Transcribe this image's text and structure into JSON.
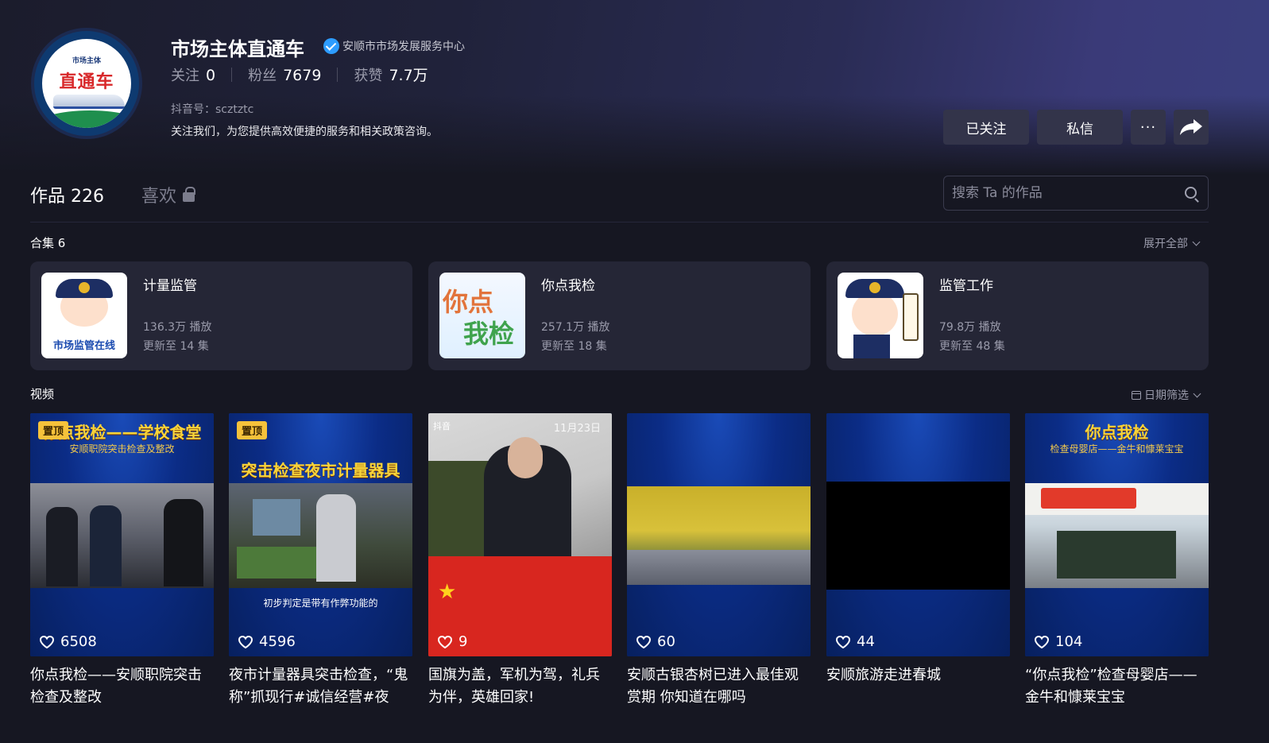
{
  "profile": {
    "avatar_small_text": "市场主体",
    "avatar_big_text": "直通车",
    "name": "市场主体直通车",
    "verified_label": "安顺市市场发展服务中心",
    "stats": [
      {
        "label": "关注",
        "value": "0"
      },
      {
        "label": "粉丝",
        "value": "7679"
      },
      {
        "label": "获赞",
        "value": "7.7万"
      }
    ],
    "douyin_id": "抖音号：scztztc",
    "bio": "关注我们，为您提供高效便捷的服务和相关政策咨询。"
  },
  "actions": {
    "followed": "已关注",
    "message": "私信",
    "more": "···"
  },
  "tabs": {
    "works": "作品 226",
    "likes": "喜欢"
  },
  "search": {
    "placeholder": "搜索 Ta 的作品"
  },
  "collections": {
    "label": "合集 6",
    "expand": "展开全部",
    "items": [
      {
        "name": "计量监管",
        "plays": "136.3万 播放",
        "updated": "更新至 14 集",
        "thumb_text": "市场监管在线"
      },
      {
        "name": "你点我检",
        "plays": "257.1万 播放",
        "updated": "更新至 18 集",
        "thumb_text_1": "你点",
        "thumb_text_2": "我检"
      },
      {
        "name": "监管工作",
        "plays": "79.8万 播放",
        "updated": "更新至 48 集"
      }
    ]
  },
  "videos": {
    "label": "视频",
    "filter": "日期筛选",
    "items": [
      {
        "pinned": "置顶",
        "headline": "你点我检——学校食堂",
        "subline": "安顺职院突击检查及整改",
        "likes": "6508",
        "title": "你点我检——安顺职院突击检查及整改"
      },
      {
        "pinned": "置顶",
        "headline": "突击检查夜市计量器具",
        "caption": "初步判定是带有作弊功能的",
        "likes": "4596",
        "title": "夜市计量器具突击检查，“鬼称”抓现行#诚信经营#夜市..."
      },
      {
        "tag": "抖音",
        "date": "11月23日",
        "likes": "9",
        "title": "国旗为盖，军机为驾，礼兵为伴，英雄回家!"
      },
      {
        "likes": "60",
        "title": "安顺古银杏树已进入最佳观赏期 你知道在哪吗"
      },
      {
        "likes": "44",
        "title": "安顺旅游走进春城"
      },
      {
        "headline": "你点我检",
        "subline": "检查母婴店——金牛和慷莱宝宝",
        "likes": "104",
        "title": "“你点我检”检查母婴店——金牛和慷莱宝宝"
      }
    ]
  },
  "colors": {
    "accent_verified": "#2d9cff",
    "pin_badge": "#f6c23b",
    "card_bg": "#252636"
  }
}
